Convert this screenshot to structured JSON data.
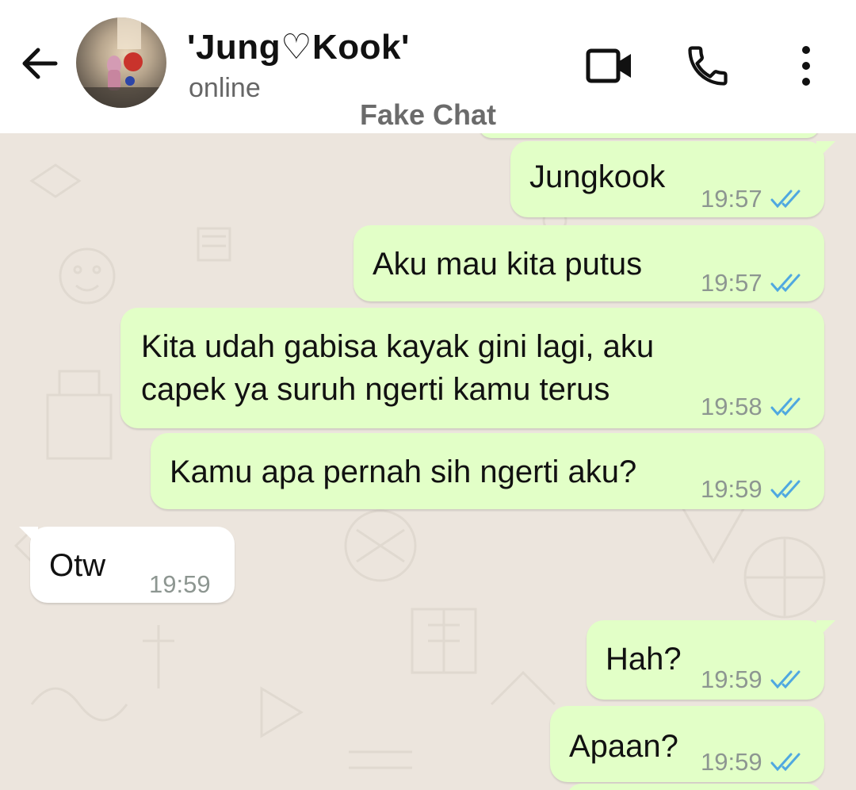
{
  "header": {
    "contact_name": "'Jung♡Kook'",
    "status": "online",
    "watermark": "Fake Chat",
    "back_icon": "arrow-left-icon",
    "video_icon": "video-camera-icon",
    "call_icon": "phone-icon",
    "more_icon": "more-vert-icon"
  },
  "colors": {
    "outgoing_bubble": "#e2ffc7",
    "incoming_bubble": "#ffffff",
    "chat_background": "#ece5dd",
    "read_tick": "#4fa8e0",
    "time_text": "#8d9691"
  },
  "messages": [
    {
      "direction": "out",
      "lines": [
        "Jungkook"
      ],
      "time": "19:57",
      "status": "read"
    },
    {
      "direction": "out",
      "lines": [
        "Aku mau kita putus"
      ],
      "time": "19:57",
      "status": "read"
    },
    {
      "direction": "out",
      "lines": [
        "Kita udah gabisa kayak gini lagi, aku",
        "capek ya suruh ngerti kamu terus"
      ],
      "time": "19:58",
      "status": "read"
    },
    {
      "direction": "out",
      "lines": [
        "Kamu apa pernah sih ngerti aku?"
      ],
      "time": "19:59",
      "status": "read"
    },
    {
      "direction": "in",
      "lines": [
        "Otw"
      ],
      "time": "19:59",
      "status": ""
    },
    {
      "direction": "out",
      "lines": [
        "Hah?"
      ],
      "time": "19:59",
      "status": "read"
    },
    {
      "direction": "out",
      "lines": [
        "Apaan?"
      ],
      "time": "19:59",
      "status": "read"
    }
  ]
}
